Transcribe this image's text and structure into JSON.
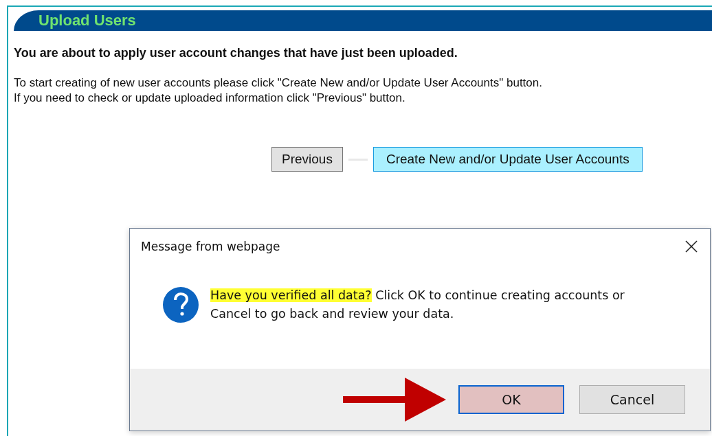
{
  "page": {
    "title": "Upload Users",
    "heading": "You are about to apply user account changes that have just been uploaded.",
    "instructions": [
      "To start creating of new user accounts please click \"Create New and/or Update User Accounts\" button.",
      "If you need to check or update uploaded information click \"Previous\" button."
    ],
    "buttons": [
      {
        "label": "Previous",
        "primary": false
      },
      {
        "label": "Create New and/or Update User Accounts",
        "primary": true
      }
    ]
  },
  "dialog": {
    "title": "Message from webpage",
    "message_highlight": "Have you verified all data?",
    "message": "Click OK to continue creating accounts or Cancel to go back and review your data.",
    "buttons": [
      {
        "label": "OK",
        "default": true
      },
      {
        "label": "Cancel",
        "default": false
      }
    ]
  }
}
